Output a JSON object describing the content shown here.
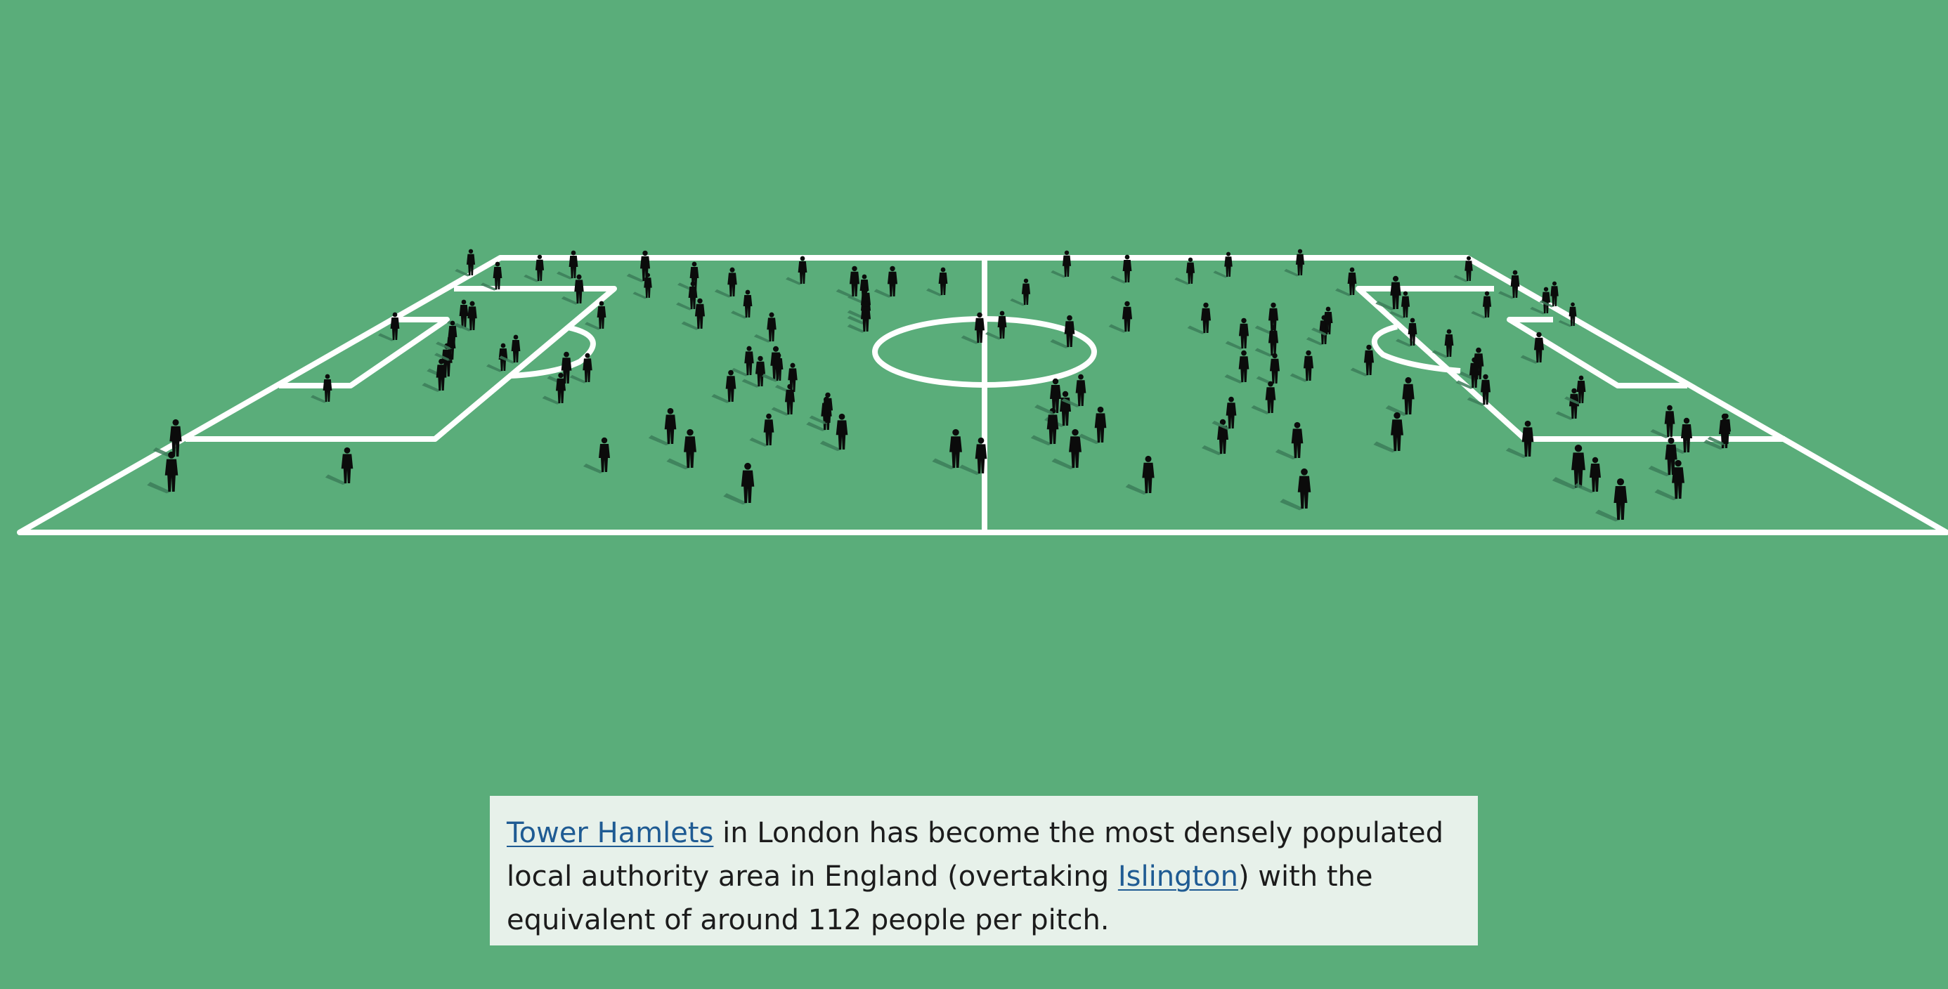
{
  "caption": {
    "link1": "Tower Hamlets",
    "text1": " in London has become the most densely populated local authority area in England (overtaking ",
    "link2": "Islington",
    "text2": ") with the equivalent of around 112 people per pitch."
  },
  "colors": {
    "background": "#5aad7a",
    "pitch_lines": "#ffffff",
    "people": "#0b0b0b",
    "shadow": "#3c7d59",
    "caption_box": "#e7f1ea",
    "link": "#1f5b93"
  },
  "people_count": 112
}
